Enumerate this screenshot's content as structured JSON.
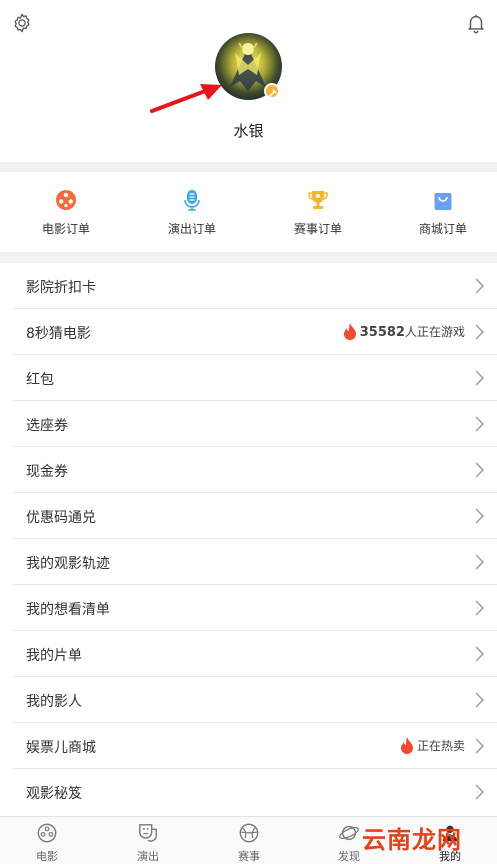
{
  "profile": {
    "username": "水银"
  },
  "orders": [
    {
      "label": "电影订单",
      "icon": "film-reel-icon",
      "color": "#f26b3a"
    },
    {
      "label": "演出订单",
      "icon": "microphone-icon",
      "color": "#3ca6e6"
    },
    {
      "label": "赛事订单",
      "icon": "trophy-icon",
      "color": "#f5b733"
    },
    {
      "label": "商城订单",
      "icon": "shopping-bag-icon",
      "color": "#6b9ff2"
    }
  ],
  "menu": [
    {
      "label": "影院折扣卡"
    },
    {
      "label": "8秒猜电影",
      "count": "35582",
      "count_suffix": "人正在游戏"
    },
    {
      "label": "红包"
    },
    {
      "label": "选座券"
    },
    {
      "label": "现金券"
    },
    {
      "label": "优惠码通兑"
    },
    {
      "label": "我的观影轨迹"
    },
    {
      "label": "我的想看清单"
    },
    {
      "label": "我的片单"
    },
    {
      "label": "我的影人"
    },
    {
      "label": "娱票儿商城",
      "badge": "正在热卖"
    },
    {
      "label": "观影秘笈"
    }
  ],
  "tabs": [
    {
      "label": "电影",
      "icon": "film-reel-icon"
    },
    {
      "label": "演出",
      "icon": "theater-mask-icon"
    },
    {
      "label": "赛事",
      "icon": "ball-icon"
    },
    {
      "label": "发现",
      "icon": "planet-icon"
    },
    {
      "label": "我的",
      "icon": "profile-icon",
      "active": true
    }
  ],
  "watermark": "云南龙网",
  "colors": {
    "flame": "#f04a32",
    "accent": "#f6b23a",
    "arrow": "#e8161b"
  }
}
